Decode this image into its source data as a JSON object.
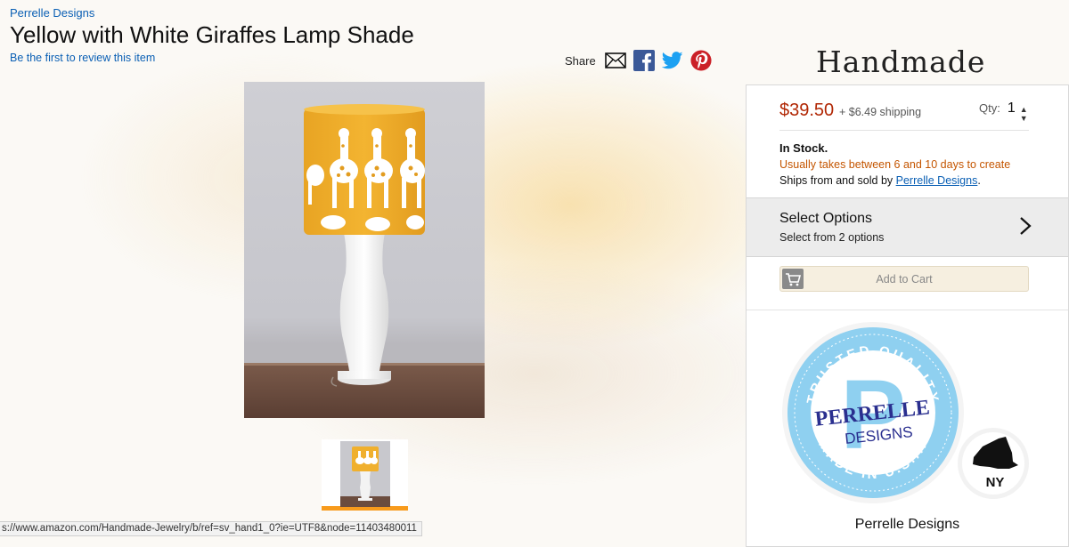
{
  "header": {
    "brand": "Perrelle Designs",
    "title": "Yellow with White Giraffes Lamp Shade",
    "review_link": "Be the first to review this item"
  },
  "share": {
    "label": "Share",
    "icons": [
      "email-icon",
      "facebook-icon",
      "twitter-icon",
      "pinterest-icon"
    ]
  },
  "gallery": {
    "main_image": "yellow giraffe lamp shade on white lamp base",
    "thumbnail": "lamp thumbnail",
    "thumbnail_selected_color": "#f89b1c"
  },
  "status_bar": {
    "url": "s://www.amazon.com/Handmade-Jewelry/b/ref=sv_hand1_0?ie=UTF8&node=11403480011"
  },
  "logo": {
    "text": "Handmade"
  },
  "buybox": {
    "price": "$39.50",
    "shipping": "+ $6.49 shipping",
    "qty_label": "Qty:",
    "qty_value": "1",
    "stock": "In Stock.",
    "lead_time": "Usually takes between 6 and 10 days to create",
    "ships_prefix": "Ships from and sold by ",
    "ships_seller": "Perrelle Designs",
    "ships_suffix": ".",
    "select_options_title": "Select Options",
    "select_options_sub": "Select from 2 options",
    "add_to_cart": "Add to Cart",
    "seller_name": "Perrelle Designs"
  },
  "seller_badge": {
    "ring_text_top": "TRUSTED QUALITY",
    "ring_text_bottom": "MADE IN U.S.A.",
    "letter": "P",
    "brand_line1": "PERRELLE",
    "brand_line2": "DESIGNS",
    "state": "NY"
  },
  "colors": {
    "link": "#0a5fb4",
    "price": "#b12704",
    "lead_time": "#c45500",
    "badge_blue": "#8fd0f0",
    "badge_navy": "#2a2f8f",
    "shade_yellow": "#f1b12e"
  }
}
